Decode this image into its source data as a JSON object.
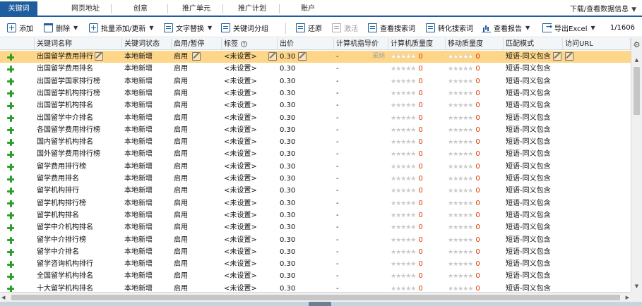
{
  "tabs": [
    {
      "label": "关键词",
      "active": true
    },
    {
      "label": "网页地址"
    },
    {
      "label": "创意"
    },
    {
      "label": "推广单元"
    },
    {
      "label": "推广计划"
    },
    {
      "label": "账户"
    }
  ],
  "tab_right": {
    "label": "下载/查看数据信息"
  },
  "toolbar": {
    "add": "添加",
    "delete": "删除",
    "batch": "批量添加/更新",
    "replace": "文字替换",
    "group": "关键词分组",
    "restore": "还原",
    "activate": "激活",
    "view_search": "查看搜索词",
    "convert_search": "转化搜索词",
    "report": "查看报告",
    "export": "导出Excel",
    "pager": "1/1606"
  },
  "columns": {
    "keyword": "关键词名称",
    "status": "关键词状态",
    "enable": "启用/暂停",
    "tag": "标签",
    "bid": "出价",
    "pc_guide": "计算机指导价",
    "pc_quality": "计算机质量度",
    "mobile_quality": "移动质量度",
    "match": "匹配模式",
    "url": "访问URL"
  },
  "selected_row": {
    "pc_guide_hint": "采纳"
  },
  "rows": [
    {
      "keyword": "出国留学费用排行",
      "status": "本地新增",
      "enable": "启用",
      "tag": "<未设置>",
      "bid": "0.30",
      "guide": "-",
      "pcq": "0",
      "mq": "0",
      "match": "短语-同义包含"
    },
    {
      "keyword": "出国留学费用排名",
      "status": "本地新增",
      "enable": "启用",
      "tag": "<未设置>",
      "bid": "0.30",
      "guide": "-",
      "pcq": "0",
      "mq": "0",
      "match": "短语-同义包含"
    },
    {
      "keyword": "出国留学国家排行榜",
      "status": "本地新增",
      "enable": "启用",
      "tag": "<未设置>",
      "bid": "0.30",
      "guide": "-",
      "pcq": "0",
      "mq": "0",
      "match": "短语-同义包含"
    },
    {
      "keyword": "出国留学机构排行榜",
      "status": "本地新增",
      "enable": "启用",
      "tag": "<未设置>",
      "bid": "0.30",
      "guide": "-",
      "pcq": "0",
      "mq": "0",
      "match": "短语-同义包含"
    },
    {
      "keyword": "出国留学机构排名",
      "status": "本地新增",
      "enable": "启用",
      "tag": "<未设置>",
      "bid": "0.30",
      "guide": "-",
      "pcq": "0",
      "mq": "0",
      "match": "短语-同义包含"
    },
    {
      "keyword": "出国留学中介排名",
      "status": "本地新增",
      "enable": "启用",
      "tag": "<未设置>",
      "bid": "0.30",
      "guide": "-",
      "pcq": "0",
      "mq": "0",
      "match": "短语-同义包含"
    },
    {
      "keyword": "各国留学费用排行榜",
      "status": "本地新增",
      "enable": "启用",
      "tag": "<未设置>",
      "bid": "0.30",
      "guide": "-",
      "pcq": "0",
      "mq": "0",
      "match": "短语-同义包含"
    },
    {
      "keyword": "国内留学机构排名",
      "status": "本地新增",
      "enable": "启用",
      "tag": "<未设置>",
      "bid": "0.30",
      "guide": "-",
      "pcq": "0",
      "mq": "0",
      "match": "短语-同义包含"
    },
    {
      "keyword": "国外留学费用排行榜",
      "status": "本地新增",
      "enable": "启用",
      "tag": "<未设置>",
      "bid": "0.30",
      "guide": "-",
      "pcq": "0",
      "mq": "0",
      "match": "短语-同义包含"
    },
    {
      "keyword": "留学费用排行榜",
      "status": "本地新增",
      "enable": "启用",
      "tag": "<未设置>",
      "bid": "0.30",
      "guide": "-",
      "pcq": "0",
      "mq": "0",
      "match": "短语-同义包含"
    },
    {
      "keyword": "留学费用排名",
      "status": "本地新增",
      "enable": "启用",
      "tag": "<未设置>",
      "bid": "0.30",
      "guide": "-",
      "pcq": "0",
      "mq": "0",
      "match": "短语-同义包含"
    },
    {
      "keyword": "留学机构排行",
      "status": "本地新增",
      "enable": "启用",
      "tag": "<未设置>",
      "bid": "0.30",
      "guide": "-",
      "pcq": "0",
      "mq": "0",
      "match": "短语-同义包含"
    },
    {
      "keyword": "留学机构排行榜",
      "status": "本地新增",
      "enable": "启用",
      "tag": "<未设置>",
      "bid": "0.30",
      "guide": "-",
      "pcq": "0",
      "mq": "0",
      "match": "短语-同义包含"
    },
    {
      "keyword": "留学机构排名",
      "status": "本地新增",
      "enable": "启用",
      "tag": "<未设置>",
      "bid": "0.30",
      "guide": "-",
      "pcq": "0",
      "mq": "0",
      "match": "短语-同义包含"
    },
    {
      "keyword": "留学中介机构排名",
      "status": "本地新增",
      "enable": "启用",
      "tag": "<未设置>",
      "bid": "0.30",
      "guide": "-",
      "pcq": "0",
      "mq": "0",
      "match": "短语-同义包含"
    },
    {
      "keyword": "留学中介排行榜",
      "status": "本地新增",
      "enable": "启用",
      "tag": "<未设置>",
      "bid": "0.30",
      "guide": "-",
      "pcq": "0",
      "mq": "0",
      "match": "短语-同义包含"
    },
    {
      "keyword": "留学中介排名",
      "status": "本地新增",
      "enable": "启用",
      "tag": "<未设置>",
      "bid": "0.30",
      "guide": "-",
      "pcq": "0",
      "mq": "0",
      "match": "短语-同义包含"
    },
    {
      "keyword": "留学咨询机构排行",
      "status": "本地新增",
      "enable": "启用",
      "tag": "<未设置>",
      "bid": "0.30",
      "guide": "-",
      "pcq": "0",
      "mq": "0",
      "match": "短语-同义包含"
    },
    {
      "keyword": "全国留学机构排名",
      "status": "本地新增",
      "enable": "启用",
      "tag": "<未设置>",
      "bid": "0.30",
      "guide": "-",
      "pcq": "0",
      "mq": "0",
      "match": "短语-同义包含"
    },
    {
      "keyword": "十大留学机构排名",
      "status": "本地新增",
      "enable": "启用",
      "tag": "<未设置>",
      "bid": "0.30",
      "guide": "-",
      "pcq": "0",
      "mq": "0",
      "match": "短语-同义包含"
    }
  ],
  "colors": {
    "accent": "#1f5e9e",
    "selected_row": "#fdd68a",
    "add_icon": "#2aa02a",
    "zero": "#e03a00"
  },
  "icons": {
    "row_add": "plus-icon",
    "edit": "edit-icon",
    "settings": "gear-icon",
    "stars": "star-icon"
  }
}
